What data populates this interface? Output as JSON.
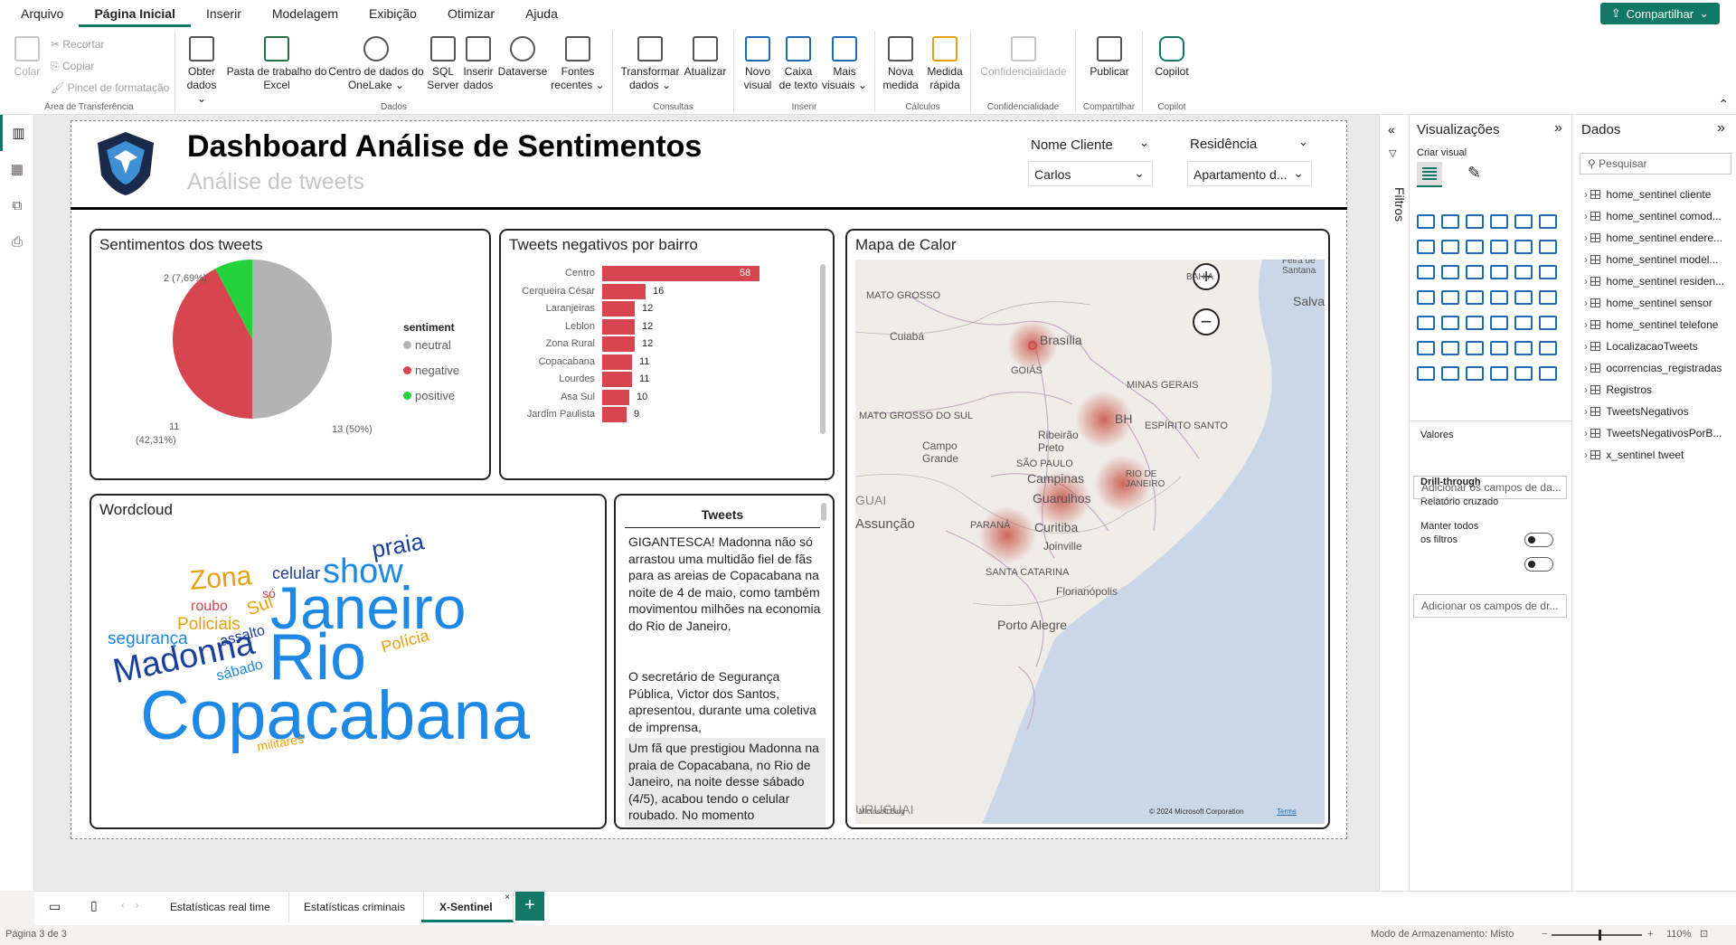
{
  "menu": {
    "items": [
      "Arquivo",
      "Página Inicial",
      "Inserir",
      "Modelagem",
      "Exibição",
      "Otimizar",
      "Ajuda"
    ],
    "share": "Compartilhar"
  },
  "ribbon": {
    "clipboard": {
      "paste": "Colar",
      "cut": "Recortar",
      "copy": "Copiar",
      "painter": "Pincel de formatação",
      "group": "Área de Transferência"
    },
    "data_buttons": [
      {
        "label": "Obter dados ⌄"
      },
      {
        "label": "Pasta de trabalho do Excel"
      },
      {
        "label": "Centro de dados do OneLake ⌄"
      },
      {
        "label": "SQL Server"
      },
      {
        "label": "Inserir dados"
      },
      {
        "label": "Dataverse"
      },
      {
        "label": "Fontes recentes ⌄"
      }
    ],
    "data_group": "Dados",
    "queries": [
      {
        "label": "Transformar dados ⌄"
      },
      {
        "label": "Atualizar"
      }
    ],
    "queries_group": "Consultas",
    "insert": [
      {
        "label": "Novo visual"
      },
      {
        "label": "Caixa de texto"
      },
      {
        "label": "Mais visuais ⌄"
      }
    ],
    "insert_group": "Inserir",
    "calc": [
      {
        "label": "Nova medida"
      },
      {
        "label": "Medida rápida"
      }
    ],
    "calc_group": "Cálculos",
    "sens": {
      "label": "Confidencialidade",
      "group": "Confidencialidade"
    },
    "share_btn": {
      "label": "Publicar",
      "group": "Compartilhar"
    },
    "copilot": {
      "label": "Copilot",
      "group": "Copilot"
    }
  },
  "report": {
    "title": "Dashboard Análise de Sentimentos",
    "subtitle": "Análise de tweets",
    "slicers": [
      {
        "label": "Nome Cliente",
        "value": "Carlos"
      },
      {
        "label": "Residência",
        "value": "Apartamento d..."
      }
    ]
  },
  "pie_panel": {
    "title": "Sentimentos dos tweets",
    "legend_title": "sentiment",
    "labels": {
      "positive": "2 (7,69%)",
      "negative_count": "11",
      "negative_pct": "(42,31%)",
      "neutral": "13 (50%)"
    }
  },
  "bar_panel": {
    "title": "Tweets negativos por bairro"
  },
  "map_panel": {
    "title": "Mapa de Calor",
    "labels": [
      "BAHIA",
      "MATO GROSSO",
      "Cuiabá",
      "Brasília",
      "GOIÁS",
      "MINAS GERAIS",
      "BH",
      "ESPÍRITO SANTO",
      "MATO GROSSO DO SUL",
      "Ribeirão Preto",
      "Campo Grande",
      "SÃO PAULO",
      "Campinas",
      "Guarulhos",
      "RIO DE JANEIRO",
      "PARANÁ",
      "Curitiba",
      "Joinville",
      "SANTA CATARINA",
      "Florianópolis",
      "Porto Alegre",
      "Assunção",
      "GUAI",
      "URUGUAI",
      "Feira de Santana",
      "Salva"
    ],
    "copyright": "© 2024 Microsoft Corporation",
    "terms": "Terms",
    "bing": "Microsoft Bing"
  },
  "wordcloud": {
    "title": "Wordcloud",
    "words": [
      "Copacabana",
      "Rio",
      "Janeiro",
      "Madonna",
      "show",
      "praia",
      "Zona",
      "celular",
      "Sul",
      "só",
      "roubo",
      "Policiais",
      "segurança",
      "assalto",
      "sábado",
      "Polícia",
      "militares"
    ]
  },
  "tweets": {
    "header": "Tweets",
    "items": [
      "GIGANTESCA! Madonna não só arrastou uma multidão fiel de fãs para as areias de Copacabana na noite de 4 de maio, como também movimentou milhões na economia do Rio de Janeiro.",
      "O secretário de Segurança Pública, Victor dos Santos, apresentou, durante uma coletiva de imprensa,",
      "Um fã que prestigiou Madonna na praia de Copacabana, no Rio de Janeiro, na noite desse sábado (4/5), acabou tendo o celular roubado. No momento"
    ]
  },
  "filters": {
    "label": "Filtros"
  },
  "visualizations": {
    "title": "Visualizações",
    "build": "Criar visual",
    "values": "Valores",
    "values_placeholder": "Adicionar os campos de da...",
    "drill": "Drill-through",
    "cross": "Relatório cruzado",
    "keep": "Manter todos os filtros",
    "drill_placeholder": "Adicionar os campos de dr..."
  },
  "data_pane": {
    "title": "Dados",
    "search": "Pesquisar",
    "tables": [
      "home_sentinel cliente",
      "home_sentinel comod...",
      "home_sentinel endere...",
      "home_sentinel model...",
      "home_sentinel residen...",
      "home_sentinel sensor",
      "home_sentinel telefone",
      "LocalizacaoTweets",
      "ocorrencias_registradas",
      "Registros",
      "TweetsNegativos",
      "TweetsNegativosPorB...",
      "x_sentinel tweet"
    ]
  },
  "pages": {
    "tabs": [
      "Estatísticas real time",
      "Estatísticas criminais",
      "X-Sentinel"
    ],
    "active": 2
  },
  "status": {
    "page": "Página 3 de 3",
    "storage": "Modo de Armazenamento: Misto",
    "zoom": "110%"
  },
  "colors": {
    "neutral": "#b3b3b3",
    "negative": "#d64550",
    "positive": "#24d33c",
    "accent": "#117865"
  },
  "chart_data": [
    {
      "type": "pie",
      "title": "Sentimentos dos tweets",
      "legend_title": "sentiment",
      "categories": [
        "neutral",
        "negative",
        "positive"
      ],
      "values": [
        13,
        11,
        2
      ],
      "percent": [
        50,
        42.31,
        7.69
      ]
    },
    {
      "type": "bar",
      "orientation": "horizontal",
      "title": "Tweets negativos por bairro",
      "categories": [
        "Centro",
        "Cerqueira César",
        "Laranjeiras",
        "Leblon",
        "Zona Rural",
        "Copacabana",
        "Lourdes",
        "Asa Sul",
        "Jardim Paulista"
      ],
      "values": [
        58,
        16,
        12,
        12,
        12,
        11,
        11,
        10,
        9
      ]
    }
  ]
}
